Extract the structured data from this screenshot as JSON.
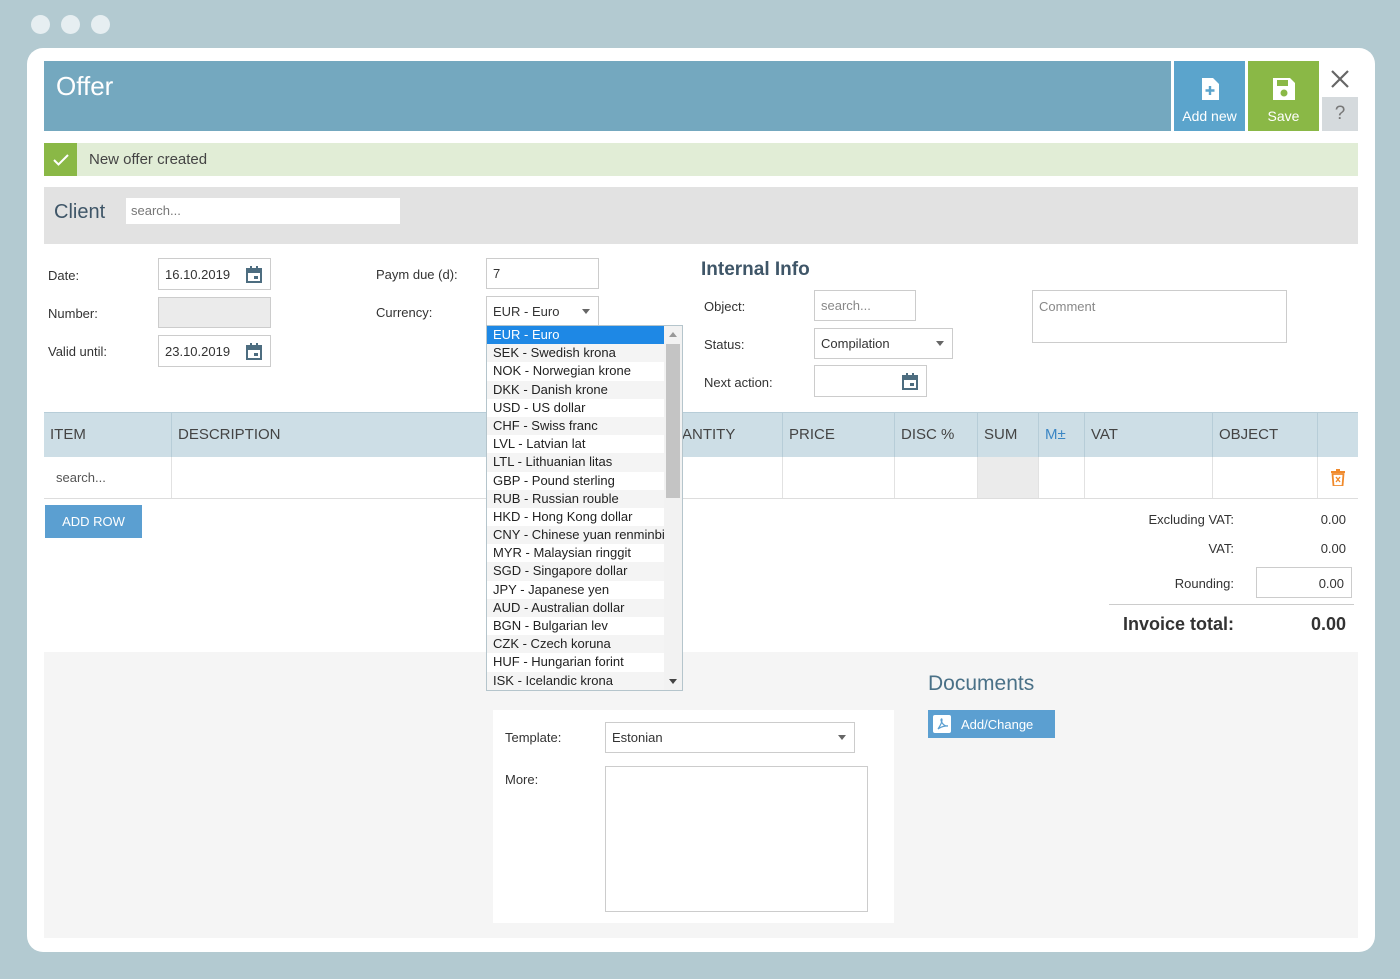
{
  "header": {
    "title": "Offer",
    "add_new_label": "Add new",
    "save_label": "Save",
    "help_label": "?"
  },
  "notification": {
    "text": "New offer created"
  },
  "client": {
    "label": "Client",
    "search_placeholder": "search..."
  },
  "form": {
    "date_label": "Date:",
    "date_value": "16.10.2019",
    "number_label": "Number:",
    "number_value": "",
    "valid_until_label": "Valid until:",
    "valid_until_value": "23.10.2019",
    "paym_due_label": "Paym due (d):",
    "paym_due_value": "7",
    "currency_label": "Currency:",
    "currency_value": "EUR - Euro"
  },
  "internal_info": {
    "title": "Internal Info",
    "object_label": "Object:",
    "object_placeholder": "search...",
    "status_label": "Status:",
    "status_value": "Compilation",
    "next_action_label": "Next action:",
    "next_action_value": "",
    "comment_placeholder": "Comment"
  },
  "table": {
    "columns": [
      "ITEM",
      "DESCRIPTION",
      "ANTITY",
      "PRICE",
      "DISC %",
      "SUM",
      "M±",
      "VAT",
      "OBJECT"
    ],
    "row_search_placeholder": "search...",
    "add_row_label": "ADD ROW"
  },
  "totals": {
    "excl_vat_label": "Excluding VAT:",
    "excl_vat_value": "0.00",
    "vat_label": "VAT:",
    "vat_value": "0.00",
    "rounding_label": "Rounding:",
    "rounding_value": "0.00",
    "invoice_total_label": "Invoice total:",
    "invoice_total_value": "0.00"
  },
  "template": {
    "template_label": "Template:",
    "template_value": "Estonian",
    "more_label": "More:"
  },
  "documents": {
    "title": "Documents",
    "add_change_label": "Add/Change"
  },
  "currency_options": [
    "EUR - Euro",
    "SEK - Swedish krona",
    "NOK - Norwegian krone",
    "DKK - Danish krone",
    "USD - US dollar",
    "CHF - Swiss franc",
    "LVL - Latvian lat",
    "LTL - Lithuanian litas",
    "GBP - Pound sterling",
    "RUB - Russian rouble",
    "HKD - Hong Kong dollar",
    "CNY - Chinese yuan renminbi",
    "MYR - Malaysian ringgit",
    "SGD - Singapore dollar",
    "JPY - Japanese yen",
    "AUD - Australian dollar",
    "BGN - Bulgarian lev",
    "CZK - Czech koruna",
    "HUF - Hungarian forint",
    "ISK - Icelandic krona"
  ],
  "colors": {
    "header": "#74a8bf",
    "save": "#8ab846",
    "add_new": "#5ba4cc",
    "selected_option": "#1e88e5"
  }
}
